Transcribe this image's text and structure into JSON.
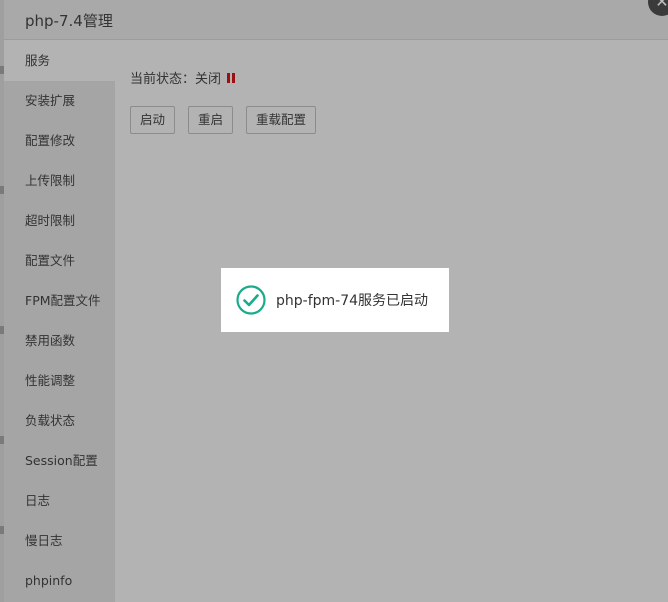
{
  "dialog": {
    "title": "php-7.4管理",
    "close_icon": "close-icon"
  },
  "sidebar": {
    "items": [
      {
        "label": "服务",
        "active": true
      },
      {
        "label": "安装扩展"
      },
      {
        "label": "配置修改"
      },
      {
        "label": "上传限制"
      },
      {
        "label": "超时限制"
      },
      {
        "label": "配置文件"
      },
      {
        "label": "FPM配置文件"
      },
      {
        "label": "禁用函数"
      },
      {
        "label": "性能调整"
      },
      {
        "label": "负载状态"
      },
      {
        "label": "Session配置"
      },
      {
        "label": "日志"
      },
      {
        "label": "慢日志"
      },
      {
        "label": "phpinfo"
      }
    ]
  },
  "main": {
    "status_label": "当前状态：关闭",
    "status_icon": "pause-icon",
    "status_color": "#9b1010",
    "buttons": {
      "start": "启动",
      "restart": "重启",
      "reload": "重载配置"
    }
  },
  "toast": {
    "icon": "check-circle-icon",
    "icon_color": "#1aab8a",
    "message": "php-fpm-74服务已启动"
  }
}
